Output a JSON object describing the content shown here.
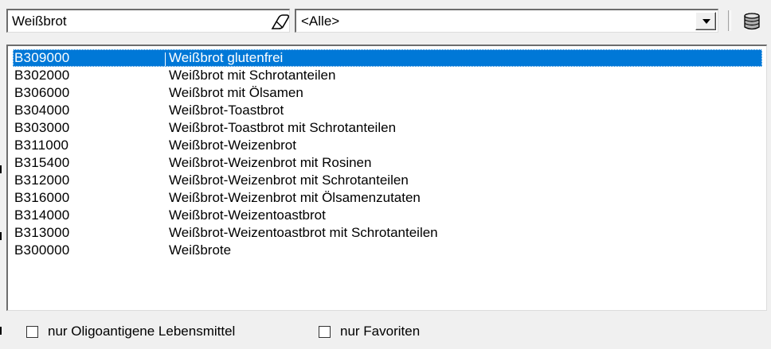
{
  "search": {
    "value": "Weißbrot"
  },
  "filter": {
    "value": "<Alle>"
  },
  "icons": {
    "clear": "eraser-icon",
    "database": "database-icon",
    "dropdown": "chevron-down-icon"
  },
  "list": {
    "rows": [
      {
        "code": "B309000",
        "name": "Weißbrot glutenfrei",
        "selected": true
      },
      {
        "code": "B302000",
        "name": "Weißbrot mit Schrotanteilen"
      },
      {
        "code": "B306000",
        "name": "Weißbrot mit Ölsamen"
      },
      {
        "code": "B304000",
        "name": "Weißbrot-Toastbrot"
      },
      {
        "code": "B303000",
        "name": "Weißbrot-Toastbrot mit Schrotanteilen"
      },
      {
        "code": "B311000",
        "name": "Weißbrot-Weizenbrot"
      },
      {
        "code": "B315400",
        "name": "Weißbrot-Weizenbrot mit Rosinen"
      },
      {
        "code": "B312000",
        "name": "Weißbrot-Weizenbrot mit Schrotanteilen"
      },
      {
        "code": "B316000",
        "name": "Weißbrot-Weizenbrot mit Ölsamenzutaten"
      },
      {
        "code": "B314000",
        "name": "Weißbrot-Weizentoastbrot"
      },
      {
        "code": "B313000",
        "name": "Weißbrot-Weizentoastbrot mit Schrotanteilen"
      },
      {
        "code": "B300000",
        "name": "Weißbrote"
      }
    ]
  },
  "options": {
    "oligo_label": "nur Oligoantigene Lebensmittel",
    "fav_label": "nur Favoriten"
  },
  "colors": {
    "selection": "#0078d7",
    "window": "#f0f0f0"
  }
}
